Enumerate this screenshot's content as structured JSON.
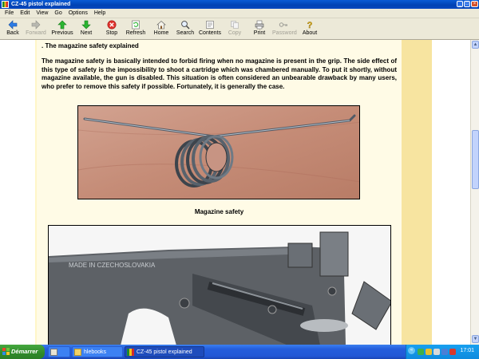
{
  "window": {
    "title": "CZ-45 pistol explained"
  },
  "menu": [
    "File",
    "Edit",
    "View",
    "Go",
    "Options",
    "Help"
  ],
  "toolbar": {
    "back": "Back",
    "forward": "Forward",
    "previous": "Previous",
    "next": "Next",
    "stop": "Stop",
    "refresh": "Refresh",
    "home": "Home",
    "search": "Search",
    "contents": "Contents",
    "copy": "Copy",
    "print": "Print",
    "password": "Password",
    "about": "About"
  },
  "content": {
    "heading": ". The magazine safety explained",
    "paragraph": "The magazine safety is basically intended to forbid firing when no magazine is present in the grip. The side effect of this type of safety is the impossibility to shoot a cartridge which was chambered manually. To put it shortly, without magazine available, the gun is disabled. This situation is often considered an unbearable drawback by many users, who prefer to remove this safety if possible. Fortunately, it is generally the case.",
    "caption1": "Magazine safety",
    "engraving": "MADE IN CZECHOSLOVAKIA"
  },
  "taskbar": {
    "start": "Démarrer",
    "tasks": [
      {
        "label": "",
        "active": false
      },
      {
        "label": "hlebooks",
        "active": false
      },
      {
        "label": "CZ-45 pistol explained",
        "active": true
      }
    ],
    "clock": "17:01"
  },
  "colors": {
    "titlebar": "#0a5bd6",
    "page": "#fffbe6",
    "band": "#f7e4a0",
    "taskbar": "#245edc",
    "start": "#3c9a36"
  }
}
